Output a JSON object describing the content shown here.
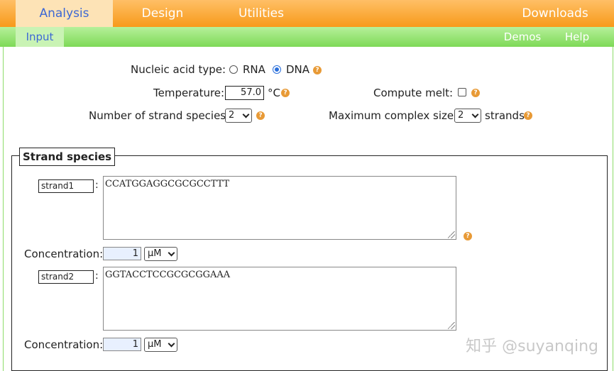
{
  "nav": {
    "tabs": [
      "Analysis",
      "Design",
      "Utilities",
      "Downloads"
    ],
    "subtabs": [
      "Input",
      "Demos",
      "Help"
    ]
  },
  "form": {
    "nucleic_label": "Nucleic acid type:",
    "rna_label": "RNA",
    "dna_label": "DNA",
    "selected_type": "DNA",
    "temp_label": "Temperature:",
    "temp_value": "57.0",
    "temp_unit": "°C",
    "melt_label": "Compute melt:",
    "melt_checked": false,
    "strand_species_label": "Number of strand species:",
    "strand_species_value": "2",
    "max_complex_label": "Maximum complex size:",
    "max_complex_value": "2",
    "strands_unit": "strands"
  },
  "strand_section": {
    "legend": "Strand species",
    "strands": [
      {
        "name": "strand1",
        "sequence": "CCATGGAGGCGCGCCTTT",
        "conc_label": "Concentration:",
        "conc_value": "1",
        "conc_unit": "μM"
      },
      {
        "name": "strand2",
        "sequence": "GGTACCTCCGCGCGGAAA",
        "conc_label": "Concentration:",
        "conc_value": "1",
        "conc_unit": "μM"
      }
    ]
  },
  "help_glyph": "?",
  "colon": ":",
  "watermark": "知乎 @suyanqing",
  "colors": {
    "top_nav": "#f79a1a",
    "sub_nav": "#7ed957",
    "active_text": "#3c67d4",
    "help_icon": "#e89a36"
  }
}
